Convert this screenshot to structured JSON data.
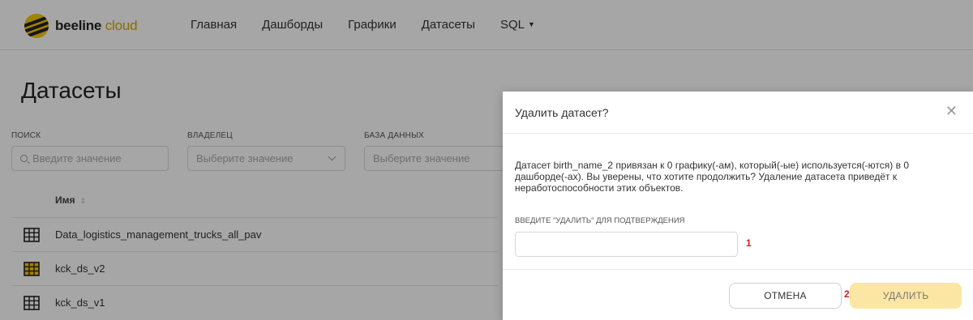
{
  "header": {
    "logo_main": "beeline",
    "logo_accent": " cloud",
    "nav": [
      "Главная",
      "Дашборды",
      "Графики",
      "Датасеты",
      "SQL"
    ]
  },
  "page": {
    "title": "Датасеты",
    "filters": {
      "search": {
        "label": "ПОИСК",
        "placeholder": "Введите значение"
      },
      "owner": {
        "label": "ВЛАДЕЛЕЦ",
        "placeholder": "Выберите значение"
      },
      "database": {
        "label": "БАЗА ДАННЫХ",
        "placeholder": "Выберите значение"
      }
    },
    "table": {
      "column_name": "Имя",
      "rows": [
        {
          "name": "Data_logistics_management_trucks_all_pav",
          "icon": "table-icon",
          "icon_color": "#222222"
        },
        {
          "name": "kck_ds_v2",
          "icon": "table-icon",
          "icon_color": "#f7c600"
        },
        {
          "name": "kck_ds_v1",
          "icon": "table-icon",
          "icon_color": "#222222"
        }
      ]
    }
  },
  "modal": {
    "title": "Удалить датасет?",
    "body": "Датасет birth_name_2 привязан к 0 графику(-ам), который(-ые) используется(-ются) в 0 дашборде(-ах). Вы уверены, что хотите продолжить? Удаление датасета приведёт к неработоспособности этих объектов.",
    "confirm_label": "ВВЕДИТЕ \"УДАЛИТЬ\" ДЛЯ ПОДТВЕРЖДЕНИЯ",
    "confirm_value": "",
    "cancel_label": "ОТМЕНА",
    "delete_label": "УДАЛИТЬ",
    "markers": [
      "1",
      "2"
    ]
  },
  "colors": {
    "brand_yellow": "#f7c600",
    "delete_button_bg": "#fbe6a3",
    "marker_red": "#d11f1f"
  }
}
